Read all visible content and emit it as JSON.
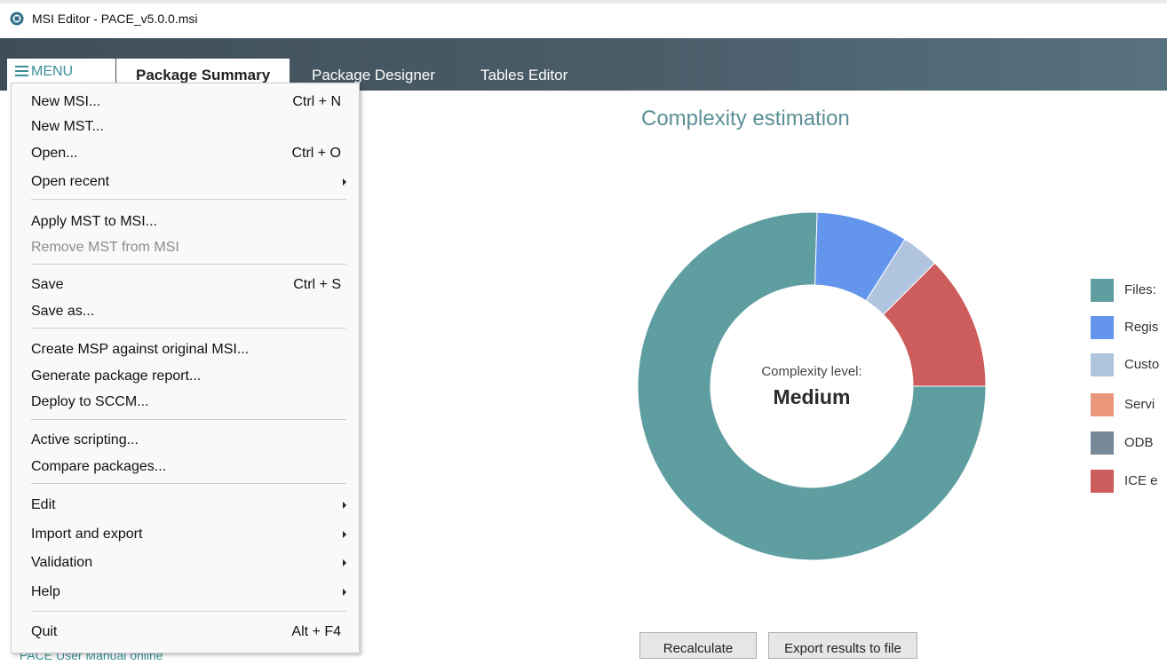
{
  "window": {
    "title": "MSI Editor - PACE_v5.0.0.msi"
  },
  "colors": {
    "accent": "#3a8f98",
    "tabbar": "#4a5d69"
  },
  "tabs": {
    "menu": "MENU",
    "package_summary": "Package Summary",
    "package_designer": "Package Designer",
    "tables_editor": "Tables Editor"
  },
  "menu": {
    "items": [
      {
        "label": "New MSI...",
        "shortcut": "Ctrl + N"
      },
      {
        "label": "New MST...",
        "shortcut": ""
      },
      {
        "label": "Open...",
        "shortcut": "Ctrl + O"
      },
      {
        "label": "Open recent",
        "shortcut": "",
        "submenu": true
      },
      {
        "label": "Apply MST to MSI...",
        "shortcut": ""
      },
      {
        "label": "Remove MST from MSI",
        "shortcut": "",
        "disabled": true
      },
      {
        "label": "Save",
        "shortcut": "Ctrl + S"
      },
      {
        "label": "Save as...",
        "shortcut": ""
      },
      {
        "label": "Create MSP against original MSI...",
        "shortcut": ""
      },
      {
        "label": "Generate package report...",
        "shortcut": ""
      },
      {
        "label": "Deploy to SCCM...",
        "shortcut": ""
      },
      {
        "label": "Active scripting...",
        "shortcut": ""
      },
      {
        "label": "Compare packages...",
        "shortcut": ""
      },
      {
        "label": "Edit",
        "shortcut": "",
        "submenu": true
      },
      {
        "label": "Import and export",
        "shortcut": "",
        "submenu": true
      },
      {
        "label": "Validation",
        "shortcut": "",
        "submenu": true
      },
      {
        "label": "Help",
        "shortcut": "",
        "submenu": true
      },
      {
        "label": "Quit",
        "shortcut": "Alt + F4"
      }
    ]
  },
  "content": {
    "title": "Complexity estimation",
    "complexity_label": "Complexity level:",
    "complexity_value": "Medium",
    "recalculate_button": "Recalculate",
    "export_button": "Export results to file",
    "bottom_link": "PACE User Manual online"
  },
  "legend": [
    {
      "label": "Files:",
      "color": "#5f9ea0",
      "icon": "legend-swatch"
    },
    {
      "label": "Regis",
      "color": "#6495ed",
      "icon": "legend-swatch"
    },
    {
      "label": "Custo",
      "color": "#b0c4de",
      "icon": "legend-swatch"
    },
    {
      "label": "Servi",
      "color": "#e9967a",
      "icon": "legend-swatch"
    },
    {
      "label": "ODB",
      "color": "#778899",
      "icon": "legend-swatch"
    },
    {
      "label": "ICE e",
      "color": "#cd5c5c",
      "icon": "legend-swatch"
    }
  ],
  "chart_data": {
    "type": "pie",
    "style": "donut",
    "title": "Complexity estimation",
    "slices": [
      {
        "name": "Files",
        "value": 75.5,
        "color": "#5f9ea0"
      },
      {
        "name": "Registry",
        "value": 8.5,
        "color": "#6495ed"
      },
      {
        "name": "Custom actions",
        "value": 3.5,
        "color": "#b0c4de"
      },
      {
        "name": "Services",
        "value": 0,
        "color": "#e9967a"
      },
      {
        "name": "ODBC",
        "value": 0,
        "color": "#778899"
      },
      {
        "name": "ICE errors",
        "value": 12.5,
        "color": "#cd5c5c"
      }
    ]
  }
}
